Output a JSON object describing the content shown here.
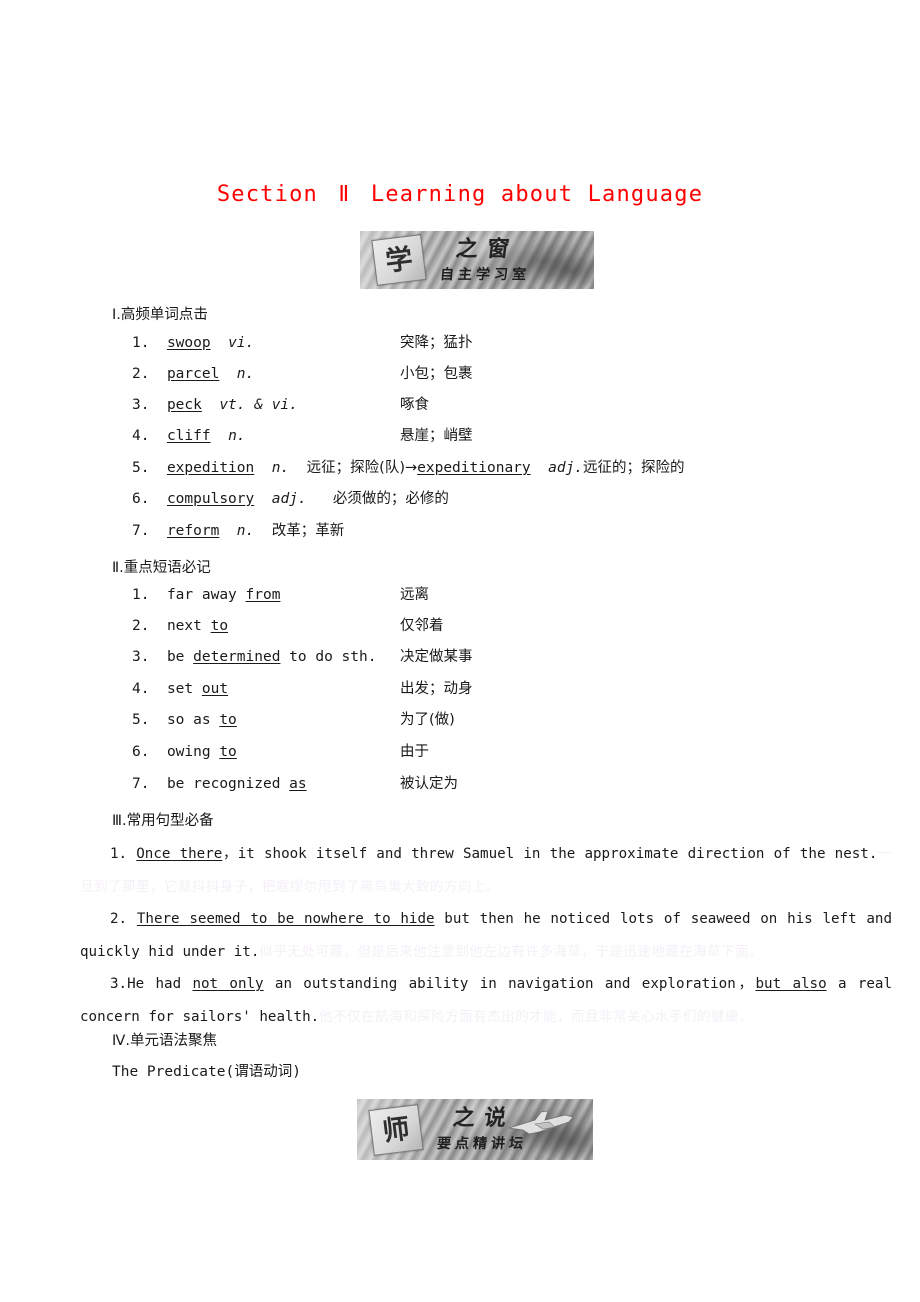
{
  "title": {
    "prefix": "Section",
    "number": "Ⅱ",
    "suffix": "Learning about Language",
    "color": "#ff0000"
  },
  "banners": [
    {
      "id": "self-study-banner",
      "seal": "学",
      "main": "之窗",
      "sub": "自主学习室"
    },
    {
      "id": "teacher-lecture-banner",
      "seal": "师",
      "main": "之说",
      "sub": "要点精讲坛"
    }
  ],
  "sections": [
    {
      "heading": "Ⅰ.高频单词点击",
      "kind": "words",
      "items": [
        {
          "num": "1.",
          "word": "swoop",
          "pos": "vi.",
          "cn": "突降；猛扑",
          "inline": false
        },
        {
          "num": "2.",
          "word": "parcel",
          "pos": "n.",
          "cn": "小包；包裹",
          "inline": false
        },
        {
          "num": "3.",
          "word": "peck",
          "pos": "vt. & vi.",
          "cn": "啄食",
          "inline": false
        },
        {
          "num": "4.",
          "word": "cliff",
          "pos": "n.",
          "cn": "悬崖；峭壁",
          "inline": false
        },
        {
          "num": "5.",
          "word": "expedition",
          "pos": "n.",
          "cn": "远征；探险(队)",
          "inline": true,
          "arrow": "→",
          "word2": "expeditionary",
          "pos2": "adj.",
          "cn2": "远征的；探险的"
        },
        {
          "num": "6.",
          "word": "compulsory",
          "pos": "adj.",
          "cn": "必须做的；必修的",
          "inline": true
        },
        {
          "num": "7.",
          "word": "reform",
          "pos": "n.",
          "cn": "改革；革新",
          "inline": true
        }
      ]
    },
    {
      "heading": "Ⅱ.重点短语必记",
      "kind": "phrases",
      "items": [
        {
          "num": "1.",
          "pre": "far away ",
          "key": "from",
          "post": "",
          "cn": "远离"
        },
        {
          "num": "2.",
          "pre": "next ",
          "key": "to",
          "post": "",
          "cn": "仅邻着"
        },
        {
          "num": "3.",
          "pre": "be ",
          "key": "determined",
          "post": " to do sth.",
          "cn": "决定做某事"
        },
        {
          "num": "4.",
          "pre": "set ",
          "key": "out",
          "post": "",
          "cn": "出发；动身"
        },
        {
          "num": "5.",
          "pre": "so as ",
          "key": "to",
          "post": "",
          "cn": "为了(做)"
        },
        {
          "num": "6.",
          "pre": "owing ",
          "key": "to",
          "post": "",
          "cn": "由于"
        },
        {
          "num": "7.",
          "pre": "be recognized ",
          "key": "as",
          "post": "",
          "cn": "被认定为"
        }
      ]
    },
    {
      "heading": "Ⅲ.常用句型必备",
      "kind": "sentences",
      "items": [
        {
          "num": "1.",
          "key": "Once there",
          "rest": "，it shook itself and threw Samuel in the approximate direction of the nest.",
          "ghost": "一旦到了那里，它就抖抖身子，把塞缪尔甩到了离鸟巢大致的方向上。"
        },
        {
          "num": "2.",
          "key": "There seemed to be nowhere to hide",
          "rest": " but then he noticed lots of seaweed on his left and quickly hid under it.",
          "ghost": "似乎无处可藏，但是后来他注意到他左边有许多海草，于是迅速地藏在海草下面。"
        },
        {
          "num": "3.",
          "pre": "He had ",
          "key": "not only",
          "mid": " an outstanding ability in navigation and exploration，",
          "key2": "but also",
          "rest": " a real concern for sailors' health.",
          "ghost": "他不仅在航海和探险方面有杰出的才能，而且非常关心水手们的健康。"
        }
      ]
    },
    {
      "heading": "Ⅳ.单元语法聚焦",
      "kind": "grammar",
      "items": [
        {
          "text": "The Predicate(谓语动词)"
        }
      ]
    }
  ]
}
